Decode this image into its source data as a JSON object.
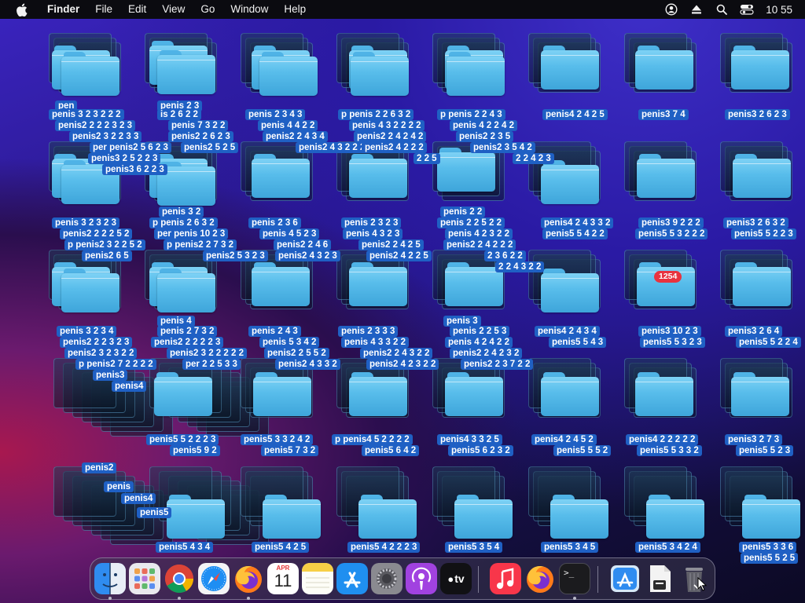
{
  "menubar": {
    "apple_icon": "apple-icon",
    "app_name": "Finder",
    "menus": [
      "File",
      "Edit",
      "View",
      "Go",
      "Window",
      "Help"
    ],
    "status_icons": [
      "user-icon",
      "eject-icon",
      "search-icon",
      "control-center-icon"
    ],
    "clock": "10 55"
  },
  "colors": {
    "label_bg": "#1f60c4",
    "folder": "#5cbfee",
    "badge": "#e8333f",
    "menubar_bg": "#0b0b10"
  },
  "desktop": {
    "badge": "1254",
    "labels": [
      "pen",
      "penis 3 2 3 2 2 2",
      "penis2 2 2 2 3 2 3",
      "penis2 3 2 2 3 3",
      "per penis2 5 6 2 3",
      "penis3 2 5 2 2 3",
      "penis3 6 2 2 3",
      "penis 2 3",
      "is 2 6 2 2",
      "penis 7 3 2 2",
      "penis2 2 6 2 3",
      "penis2 5 2 5",
      "penis 2 3 4 3",
      "penis 4 4 2 2",
      "penis2 2 4 3 4",
      "penis2 4 3 2 2 2",
      "p penis 2 2 6 3 2",
      "penis 4 3 2 2 2 2",
      "penis2 2 4 2 4 2",
      "penis2 4 2 2 2",
      "2 2 5",
      "p penis 2 2 4 3",
      "penis 4 2 2 4 2",
      "penis2 2 3 5",
      "penis2 3 5 4 2",
      "2 2 4 2 3",
      "penis4 2 4 2 5",
      "penis3 7 4",
      "penis3 2 6 2 3",
      "penis 3 2 3 2 3",
      "penis2 2 2 2 5 2",
      "p penis2 3 2 2 5 2",
      "penis2 6 5",
      "penis 3 2",
      "p penis 2 6 3 2",
      "per penis 10 2 3",
      "p penis2 2 7 3 2",
      "penis2 5 3 2 3",
      "penis 2 3 6",
      "penis 4 5 2 3",
      "penis2 2 4 6",
      "penis2 4 3 2 3",
      "penis 2 3 2 3",
      "penis 4 3 2 3",
      "penis2 2 4 2 5",
      "penis2 4 2 2 5",
      "penis 2 2",
      "penis 2 2 5 2 2",
      "penis 4 2 3 2 2",
      "penis2 2 4 2 2 2",
      "2 3 6 2 2",
      "2 2 4 3 2 2",
      "penis4 2 4 3 3 2",
      "penis5 5 4 2 2",
      "penis3 9 2 2 2",
      "penis5 5 3 2 2 2",
      "penis3 2 6 3 2",
      "penis5 5 2 2 3",
      "penis 3 2 3 4",
      "penis2 2 2 3 2 3",
      "penis2 3 2 3 2 2",
      "p penis2 7 2 2 2 2",
      "penis3",
      "penis4",
      "penis 4",
      "penis 2 7 3 2",
      "penis2 2 2 2 2 3",
      "penis2 3 2 2 2 2 2",
      "per 2 2 5 3 3",
      "penis 2 4 3",
      "penis 5 3 4 2",
      "penis2 2 5 5 2",
      "penis2 4 3 3 2",
      "penis 2 3 3 3",
      "penis 4 3 3 2 2",
      "penis2 2 4 3 2 2",
      "penis2 4 2 3 2 2",
      "penis 3",
      "penis 2 2 5 3",
      "penis 4 2 4 2 2",
      "penis2 2 4 2 3 2",
      "penis2 2 3 7 2 2",
      "penis4 2 4 3 4",
      "penis5 5 4 3",
      "penis3 10 2 3",
      "penis5 5 3 2 3",
      "penis3 2 6 4",
      "penis5 5 2 2 4",
      "penis5 5 2 2 2 3",
      "penis5 9 2",
      "penis5 3 3 2 4 2",
      "penis5 7 3 2",
      "p penis4 5 2 2 2 2",
      "penis5 6 4 2",
      "penis4 3 3 2 5",
      "penis5 6 2 3 2",
      "penis4 2 4 5 2",
      "penis5 5 5 2",
      "penis4 2 2 2 2 2",
      "penis5 5 3 3 2",
      "penis3 2 7 3",
      "penis5 5 2 3",
      "penis5 4 3 4",
      "penis5 4 2 5",
      "penis5 4 2 2 2 3",
      "penis5 3 5 4",
      "penis5 3 4 5",
      "penis5 3 4 2 4",
      "penis5 3 3 6",
      "penis5 5 2 5",
      "penis2",
      "penis",
      "penis4",
      "penis5"
    ]
  },
  "dock": {
    "items": [
      {
        "name": "finder-icon",
        "label": "Finder"
      },
      {
        "name": "launchpad-icon",
        "label": "Launchpad"
      },
      {
        "name": "chrome-icon",
        "label": "Chrome"
      },
      {
        "name": "safari-icon",
        "label": "Safari"
      },
      {
        "name": "firefox-icon",
        "label": "Firefox"
      },
      {
        "name": "calendar-icon",
        "label": "Calendar",
        "month": "APR",
        "day": "11"
      },
      {
        "name": "notes-icon",
        "label": "Notes"
      },
      {
        "name": "app-store-icon",
        "label": "App Store"
      },
      {
        "name": "system-settings-icon",
        "label": "System Settings"
      },
      {
        "name": "podcasts-icon",
        "label": "Podcasts"
      },
      {
        "name": "apple-tv-icon",
        "label": "TV",
        "text": "tv"
      },
      {
        "name": "music-icon",
        "label": "Music"
      },
      {
        "name": "firefox-icon-2",
        "label": "Firefox"
      },
      {
        "name": "terminal-icon",
        "label": "Terminal",
        "text": ">_"
      },
      {
        "name": "downloads-stack-icon",
        "label": "Downloads"
      },
      {
        "name": "document-stack-icon",
        "label": "Documents"
      },
      {
        "name": "trash-icon",
        "label": "Trash"
      }
    ]
  }
}
